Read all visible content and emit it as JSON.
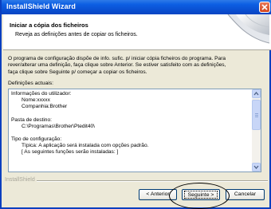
{
  "window": {
    "title": "InstallShield Wizard"
  },
  "header": {
    "title": "Iniciar a cópia dos ficheiros",
    "subtitle": "Reveja as definições antes de copiar os ficheiros."
  },
  "description": {
    "lines": [
      "O programa de configuração dispõe de info. sufic. p/ iniciar cópia ficheiros do programa.  Para",
      "rever/alterar uma definição, faça clique sobre Anterior.  Se estiver satisfeito com as definições,",
      "faça clique sobre Seguinte p/ começar a copiar os ficheiros."
    ]
  },
  "current_settings_label": "Definições actuais:",
  "settings": {
    "user_info_label": "Informações do utilizador:",
    "name": "Nome:xxxxx",
    "company": "Companhia:Brother",
    "dest_label": "Pasta de destino:",
    "dest_path": "C:\\Programas\\Brother\\Ptedit40\\",
    "setup_type_label": "Tipo de configuração:",
    "setup_type": "Típica: A aplicação será instalada com opções padrão.",
    "features_note": "[ As seguintes funções serão instaladas: ]"
  },
  "footer": {
    "brand": "InstallShield"
  },
  "buttons": {
    "back": "< Anterior",
    "next": "Seguinte >",
    "cancel": "Cancelar"
  }
}
